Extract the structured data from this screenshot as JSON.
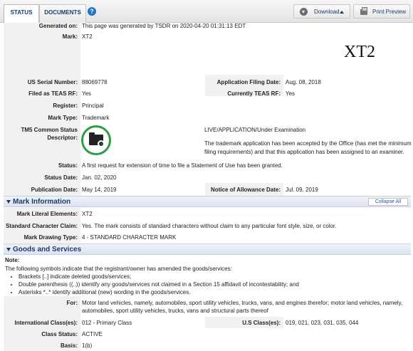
{
  "tabs": {
    "status": "STATUS",
    "documents": "DOCUMENTS",
    "help": "?"
  },
  "toolbar": {
    "download": "Download",
    "print": "Print Preview"
  },
  "mark_image_text": "XT2",
  "fields": {
    "generated_label": "Generated on:",
    "generated_value": "This page was generated by TSDR on 2020-04-20 01:31:13 EDT",
    "mark_label": "Mark:",
    "mark_value": "XT2",
    "serial_label": "US Serial Number:",
    "serial_value": "88069778",
    "filing_label": "Application Filing Date:",
    "filing_value": "Aug. 08, 2018",
    "teas_label": "Filed as TEAS RF:",
    "teas_value": "Yes",
    "current_teas_label": "Currently TEAS RF:",
    "current_teas_value": "Yes",
    "register_label": "Register:",
    "register_value": "Principal",
    "marktype_label": "Mark Type:",
    "marktype_value": "Trademark",
    "tm5_label_1": "TM5 Common Status",
    "tm5_label_2": "Descriptor:",
    "tm5_status": "LIVE/APPLICATION/Under Examination",
    "tm5_desc_1": "The trademark application has been accepted by the Office (has met the minimum",
    "tm5_desc_2": "filing requirements) and that this application has been assigned to an examiner.",
    "status_label": "Status:",
    "status_value": "A first request for extension of time to file a Statement of Use has been granted.",
    "status_date_label": "Status Date:",
    "status_date_value": "Jan. 02, 2020",
    "pub_label": "Publication Date:",
    "pub_value": "May 14, 2019",
    "allowance_label": "Notice of Allowance Date:",
    "allowance_value": "Jul. 09, 2019"
  },
  "mark_info": {
    "title": "Mark Information",
    "collapse": "Collapse All",
    "literal_label": "Mark Literal Elements:",
    "literal_value": "XT2",
    "claim_label": "Standard Character Claim:",
    "claim_value": "Yes. The mark consists of standard characters without claim to any particular font style, size, or color.",
    "drawing_label": "Mark Drawing Type:",
    "drawing_value": "4 - STANDARD CHARACTER MARK"
  },
  "goods": {
    "title": "Goods and Services",
    "note_label": "Note:",
    "note_text": "The following symbols indicate that the registrant/owner has amended the goods/services:",
    "bullets": [
      "Brackets [..] indicate deleted goods/services;",
      "Double parenthesis ((..)) identify any goods/services not claimed in a Section 15 affidavit of incontestability; and",
      "Asterisks *..* identify additional (new) wording in the goods/services."
    ],
    "for_label": "For:",
    "for_value_1": "Motor land vehicles, namely, automobiles, sport utility vehicles, trucks, vans, and engines therefor; motor land vehicles, namely,",
    "for_value_2": "automobiles, sport utility vehicles, trucks, vans and structural parts thereof",
    "intl_label": "International Class(es):",
    "intl_value": "012 - Primary Class",
    "us_label": "U.S Class(es):",
    "us_value": "019, 021, 023, 031, 035, 044",
    "class_status_label": "Class Status:",
    "class_status_value": "ACTIVE",
    "basis_label": "Basis:",
    "basis_value": "1(b)"
  }
}
